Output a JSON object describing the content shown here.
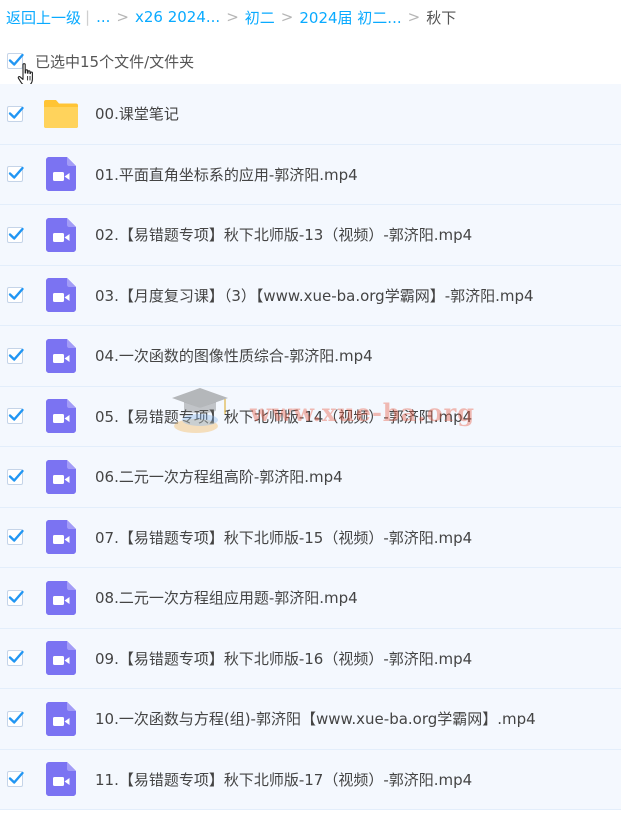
{
  "breadcrumb": {
    "back_label": "返回上一级",
    "ellipsis": "...",
    "crumbs": [
      "x26 2024...",
      "初二",
      "2024届 初二..."
    ],
    "current": "秋下"
  },
  "selection": {
    "label": "已选中15个文件/文件夹",
    "checked": true
  },
  "files": [
    {
      "name": "00.课堂笔记",
      "type": "folder",
      "checked": true
    },
    {
      "name": "01.平面直角坐标系的应用-郭济阳.mp4",
      "type": "video",
      "checked": true
    },
    {
      "name": "02.【易错题专项】秋下北师版-13（视频）-郭济阳.mp4",
      "type": "video",
      "checked": true
    },
    {
      "name": "03.【月度复习课】（3）【www.xue-ba.org学霸网】-郭济阳.mp4",
      "type": "video",
      "checked": true
    },
    {
      "name": "04.一次函数的图像性质综合-郭济阳.mp4",
      "type": "video",
      "checked": true
    },
    {
      "name": "05.【易错题专项】秋下北师版-14（视频）-郭济阳.mp4",
      "type": "video",
      "checked": true
    },
    {
      "name": "06.二元一次方程组高阶-郭济阳.mp4",
      "type": "video",
      "checked": true
    },
    {
      "name": "07.【易错题专项】秋下北师版-15（视频）-郭济阳.mp4",
      "type": "video",
      "checked": true
    },
    {
      "name": "08.二元一次方程组应用题-郭济阳.mp4",
      "type": "video",
      "checked": true
    },
    {
      "name": "09.【易错题专项】秋下北师版-16（视频）-郭济阳.mp4",
      "type": "video",
      "checked": true
    },
    {
      "name": "10.一次函数与方程(组)-郭济阳【www.xue-ba.org学霸网】.mp4",
      "type": "video",
      "checked": true
    },
    {
      "name": "11.【易错题专项】秋下北师版-17（视频）-郭济阳.mp4",
      "type": "video",
      "checked": true
    }
  ],
  "watermark": {
    "text": "www.xue-ba.org"
  },
  "colors": {
    "link": "#09AAFF",
    "checkbox": "#2196F3",
    "folder": "#FFCB42",
    "video": "#7B73F2",
    "row_bg": "#F4F8FE"
  }
}
